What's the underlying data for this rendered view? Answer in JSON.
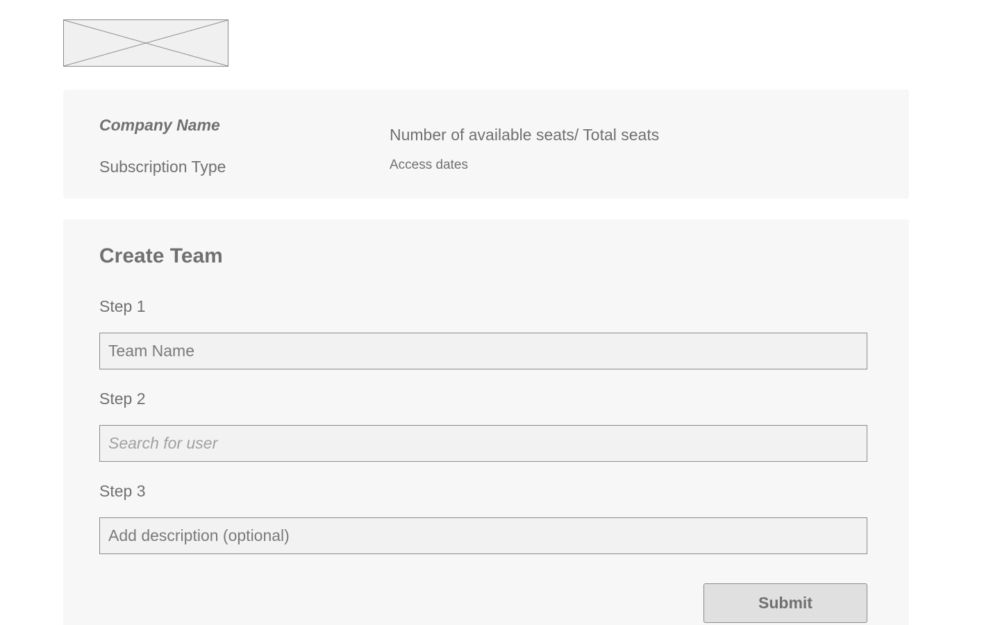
{
  "logo": {
    "icon": "image-placeholder-icon"
  },
  "info": {
    "company_name": "Company Name",
    "subscription_type": "Subscription Type",
    "seats": "Number of available seats/ Total seats",
    "access_dates": "Access dates"
  },
  "form": {
    "title": "Create Team",
    "step1": {
      "label": "Step 1",
      "placeholder": "Team Name"
    },
    "step2": {
      "label": "Step 2",
      "placeholder": "Search for user"
    },
    "step3": {
      "label": "Step 3",
      "placeholder": "Add description (optional)"
    },
    "submit_label": "Submit"
  },
  "colors": {
    "text": "#707070",
    "panel_bg": "#f7f7f7",
    "field_bg": "#f2f2f2",
    "button_bg": "#e0e0e0",
    "border": "#8a8a8a"
  }
}
